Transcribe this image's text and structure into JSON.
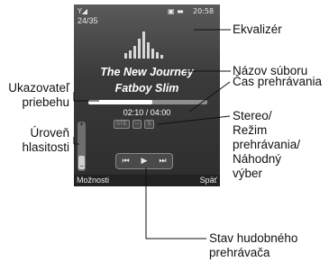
{
  "phone": {
    "signal": "Y◢",
    "status_icons": "▣ ▬",
    "clock": "20:58",
    "track_count": "24/35",
    "song_title": "The New Journey",
    "artist": "Fatboy Slim",
    "time": "02:10 / 04:00",
    "progress": 0.54,
    "volume_level": 0.35,
    "modes": [
      "STE",
      "▫▫",
      "⇅"
    ],
    "controls": {
      "prev": "⏮",
      "play": "▶",
      "next": "⏭"
    },
    "soft_left": "Možnosti",
    "soft_right": "Späť"
  },
  "callouts": {
    "equalizer": "Ekvalizér",
    "file_name": "Názov súboru",
    "progress_indicator": [
      "Ukazovateľ",
      "priebehu"
    ],
    "play_time": "Čas prehrávania",
    "stereo_mode": [
      "Stereo/",
      "Režim",
      "prehrávania/",
      "Náhodný",
      "výber"
    ],
    "volume_level": [
      "Úroveň",
      "hlasitosti"
    ],
    "player_status": [
      "Stav hudobného",
      "prehrávača"
    ]
  }
}
